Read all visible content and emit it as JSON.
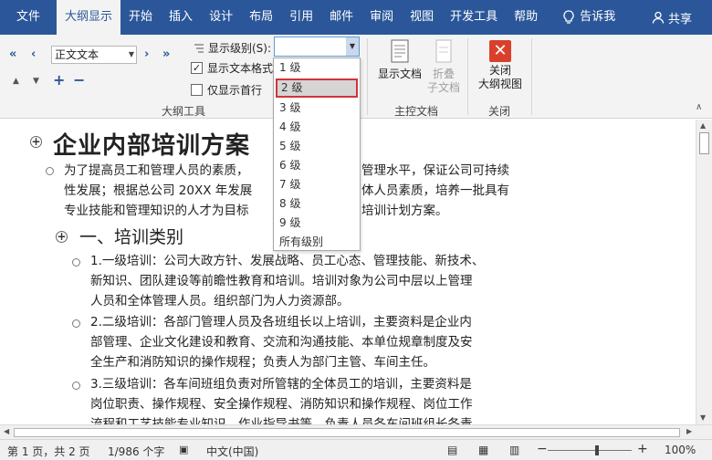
{
  "tabs": [
    "文件",
    "大纲显示",
    "开始",
    "插入",
    "设计",
    "布局",
    "引用",
    "邮件",
    "审阅",
    "视图",
    "开发工具",
    "帮助"
  ],
  "active_tab": "大纲显示",
  "tell_me": "告诉我",
  "share": "共享",
  "ribbon": {
    "level_value": "正文文本",
    "show_level_label": "显示级别(S):",
    "show_level_value": "",
    "show_text_format": "显示文本格式",
    "show_first_line": "仅显示首行",
    "outline_tools_label": "大纲工具",
    "show_document": "显示文档",
    "collapse_subdoc_1": "折叠",
    "collapse_subdoc_2": "子文档",
    "master_doc_label": "主控文档",
    "close_outline_1": "关闭",
    "close_outline_2": "大纲视图",
    "close_label": "关闭"
  },
  "dropdown": {
    "items": [
      "1 级",
      "2 级",
      "3 级",
      "4 级",
      "5 级",
      "6 级",
      "7 级",
      "8 级",
      "9 级",
      "所有级别"
    ],
    "selected": "2 级"
  },
  "document": {
    "title": "企业内部培训方案",
    "intro": [
      "为了提高员工和管理人员的素质，",
      "管理水平，保证公司可持续",
      "性发展；根据总公司 20XX 年发展",
      "体人员素质，培养一批具有",
      "专业技能和管理知识的人才为目标",
      "培训计划方案。"
    ],
    "section": "一、培训类别",
    "item1": [
      "1.一级培训：公司大政方针、发展战略、员工心态、管理技能、新技术、",
      "新知识、团队建设等前瞻性教育和培训。培训对象为公司中层以上管理",
      "人员和全体管理人员。组织部门为人力资源部。"
    ],
    "item2": [
      "2.二级培训：各部门管理人员及各班组长以上培训，主要资料是企业内",
      "部管理、企业文化建设和教育、交流和沟通技能、本单位规章制度及安",
      "全生产和消防知识的操作规程；负责人为部门主管、车间主任。"
    ],
    "item3": [
      "3.三级培训：各车间班组负责对所管辖的全体员工的培训，主要资料是",
      "岗位职责、操作规程、安全操作规程、消防知识和操作规程、岗位工作",
      "流程和工艺技能专业知识，作业指导书等，负责人员各车间班组长各责"
    ]
  },
  "status": {
    "page": "第 1 页，共 2 页",
    "words": "1/986 个字",
    "language": "中文(中国)",
    "zoom": "100%"
  },
  "colors": {
    "ribbon_blue": "#2b579a",
    "highlight_red": "#d13438"
  }
}
